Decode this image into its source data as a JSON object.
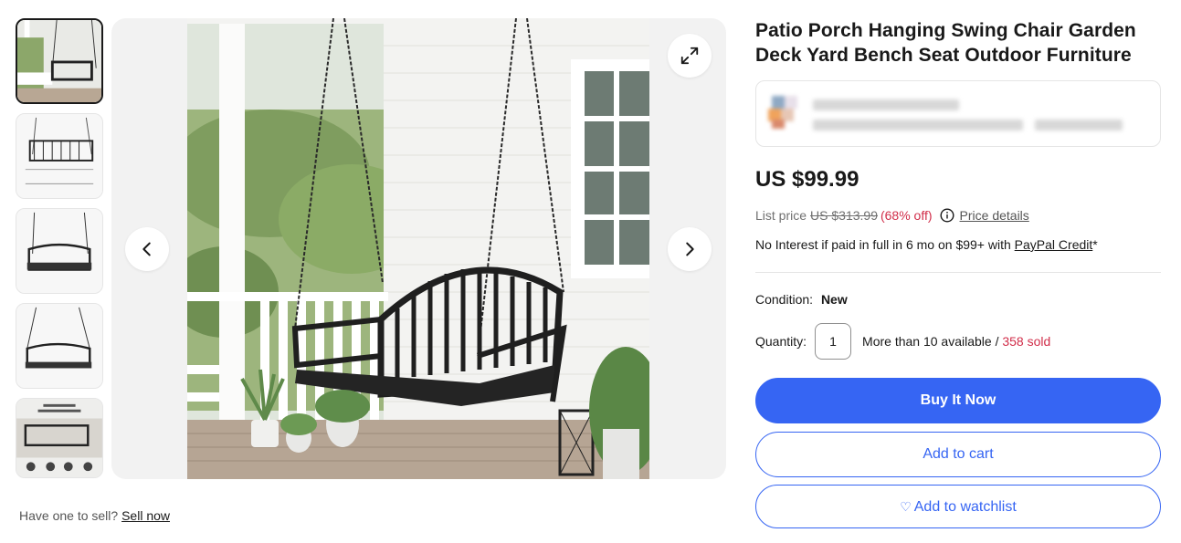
{
  "product": {
    "title": "Patio Porch Hanging Swing Chair Garden Deck Yard Bench Seat Outdoor Furniture",
    "price": "US $99.99",
    "list_price_label": "List price",
    "list_price": "US $313.99",
    "discount": "(68% off)",
    "price_details_link": "Price details",
    "credit_text": "No Interest if paid in full in 6 mo on $99+ with",
    "credit_link": "PayPal Credit",
    "credit_suffix": "*",
    "condition_label": "Condition:",
    "condition_value": "New",
    "quantity_label": "Quantity:",
    "quantity_value": "1",
    "availability": "More than 10 available /",
    "sold": "358 sold"
  },
  "actions": {
    "buy_now": "Buy It Now",
    "add_to_cart": "Add to cart",
    "add_to_watchlist": "Add to watchlist"
  },
  "gallery": {
    "thumbnail_count": 5,
    "selected_index": 0
  },
  "sell": {
    "prompt": "Have one to sell?",
    "link": "Sell now"
  },
  "colors": {
    "accent": "#3665f3",
    "discount": "#d12e4a"
  }
}
